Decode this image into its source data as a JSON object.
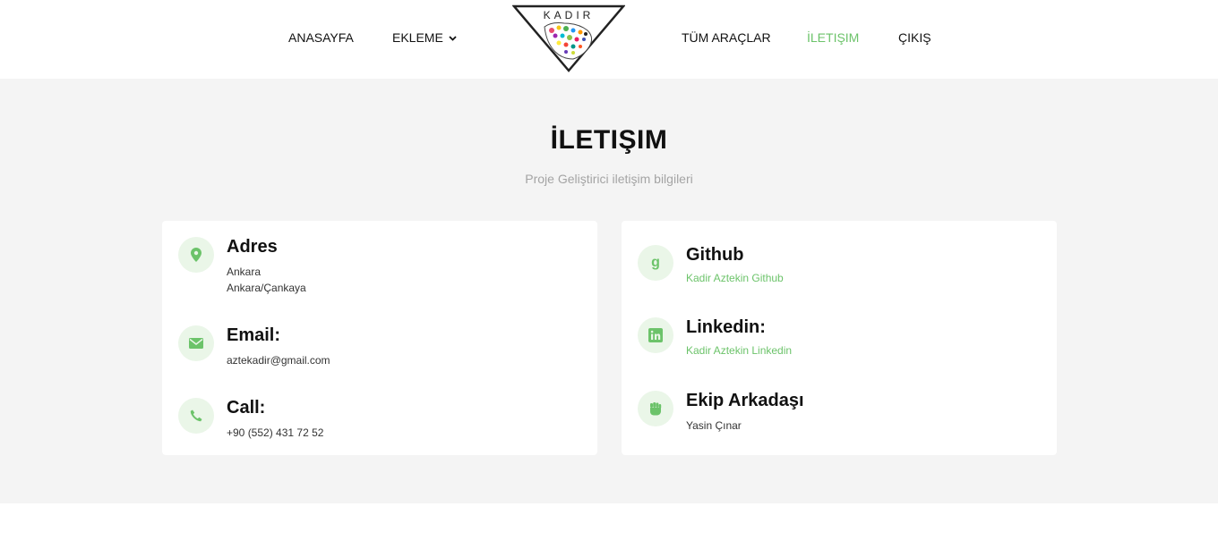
{
  "nav": {
    "home": "ANASAYFA",
    "add": "EKLEME",
    "all_tools": "TÜM ARAÇLAR",
    "contact": "İLETIŞIM",
    "logout": "ÇIKIŞ",
    "logo_text": "KADIR",
    "active_color": "#6cc36a"
  },
  "page": {
    "title": "İLETIŞIM",
    "subtitle": "Proje Geliştirici iletişim bilgileri"
  },
  "left_card": {
    "address": {
      "title": "Adres",
      "line1": "Ankara",
      "line2": "Ankara/Çankaya",
      "icon": "map-pin-icon"
    },
    "email": {
      "title": "Email:",
      "value": "aztekadir@gmail.com",
      "icon": "envelope-icon"
    },
    "call": {
      "title": "Call:",
      "value": "+90 (552) 431 72 52",
      "icon": "phone-icon"
    }
  },
  "right_card": {
    "github": {
      "title": "Github",
      "link": "Kadir Aztekin Github",
      "icon": "github-icon"
    },
    "linkedin": {
      "title": "Linkedin:",
      "link": "Kadir Aztekin Linkedin",
      "icon": "linkedin-icon"
    },
    "teammate": {
      "title": "Ekip Arkadaşı",
      "value": "Yasin Çınar",
      "icon": "fist-icon"
    }
  }
}
